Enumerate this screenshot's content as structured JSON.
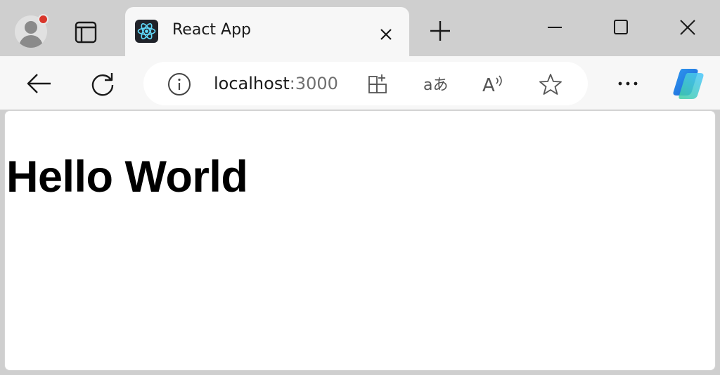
{
  "tab": {
    "title": "React App",
    "favicon": "react-logo-icon"
  },
  "address_bar": {
    "host": "localhost",
    "port": ":3000"
  },
  "page": {
    "heading": "Hello World"
  },
  "icons": {
    "profile": "profile-avatar-icon",
    "sidebar": "sidebar-toggle-icon",
    "close_tab": "close-icon",
    "new_tab": "plus-icon",
    "minimize": "minimize-icon",
    "maximize": "maximize-icon",
    "close_window": "close-icon",
    "back": "back-arrow-icon",
    "refresh": "refresh-icon",
    "site_info": "info-icon",
    "apps": "app-available-icon",
    "translate": "translate-icon",
    "read_aloud": "read-aloud-icon",
    "favorite": "star-icon",
    "more": "more-icon",
    "copilot": "copilot-icon"
  },
  "colors": {
    "frame": "#cfcfcf",
    "toolbar": "#f7f7f7",
    "notification_dot": "#d9362b",
    "react_blue": "#61dafb"
  }
}
